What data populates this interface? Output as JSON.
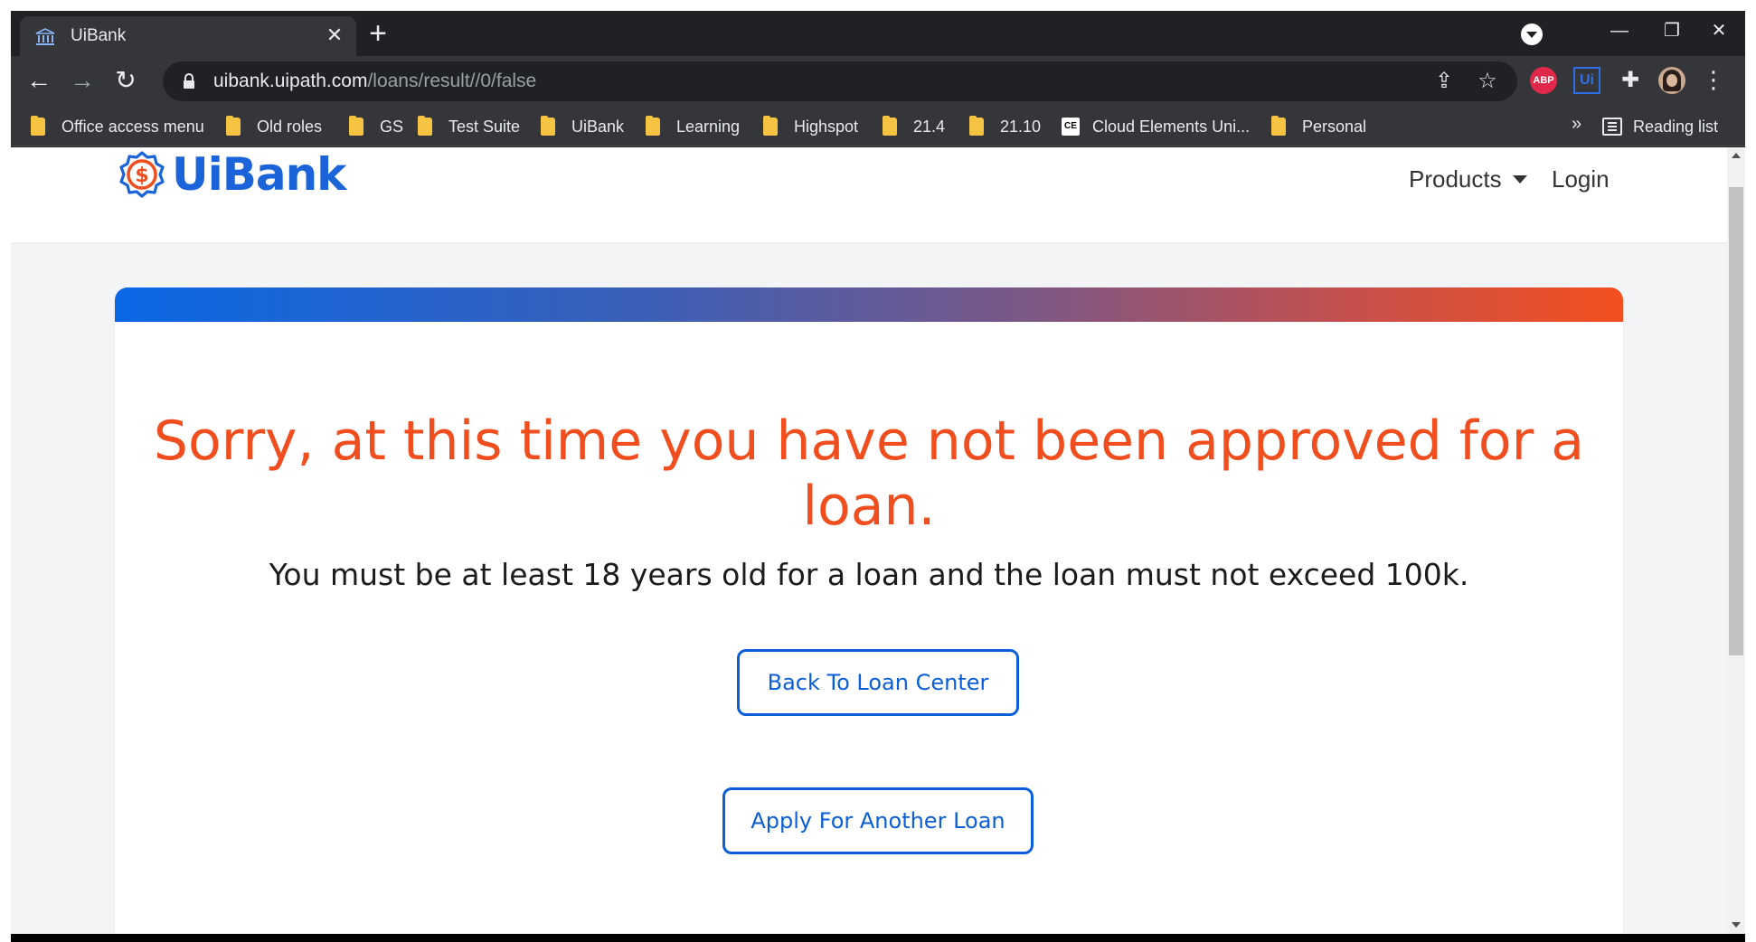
{
  "browser": {
    "tab_title": "UiBank",
    "url_host": "uibank.uipath.com",
    "url_path": "/loans/result//0/false",
    "extensions": {
      "abp_label": "ABP",
      "uipath_label": "Ui"
    },
    "bookmarks": [
      {
        "label": "Office access menu",
        "icon": "folder-icon"
      },
      {
        "label": "Old roles",
        "icon": "folder-icon"
      },
      {
        "label": "GS",
        "icon": "folder-icon"
      },
      {
        "label": "Test Suite",
        "icon": "folder-icon"
      },
      {
        "label": "UiBank",
        "icon": "folder-icon"
      },
      {
        "label": "Learning",
        "icon": "folder-icon"
      },
      {
        "label": "Highspot",
        "icon": "folder-icon"
      },
      {
        "label": "21.4",
        "icon": "folder-icon"
      },
      {
        "label": "21.10",
        "icon": "folder-icon"
      },
      {
        "label": "Cloud Elements Uni...",
        "icon": "cloud-elements-icon",
        "icon_text": "CE"
      },
      {
        "label": "Personal",
        "icon": "folder-icon"
      }
    ],
    "bookmarks_more": "»",
    "reading_list": "Reading list"
  },
  "site": {
    "brand": "UiBank",
    "nav": {
      "products": "Products",
      "login": "Login"
    }
  },
  "result": {
    "headline": "Sorry, at this time you have not been approved for a loan.",
    "message": "You must be at least 18 years old for a loan and the loan must not exceed 100k.",
    "back_button": "Back To Loan Center",
    "apply_button": "Apply For Another Loan"
  },
  "colors": {
    "brand_blue": "#1a63d8",
    "error_orange": "#f04e1f",
    "button_blue": "#0a5fd8"
  }
}
